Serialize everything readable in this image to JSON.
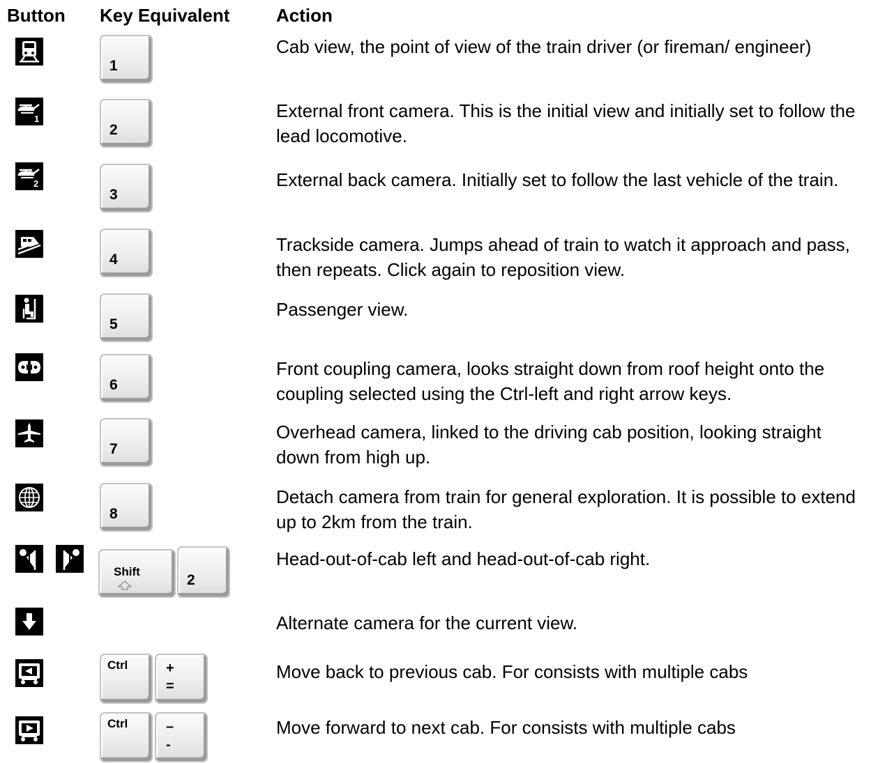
{
  "headers": {
    "button": "Button",
    "key": "Key Equivalent",
    "action": "Action"
  },
  "rows": [
    {
      "icon": "cab-view-icon",
      "key": "1",
      "action": "Cab view, the point of view of the train driver (or fireman/ engineer)"
    },
    {
      "icon": "external-front-camera-icon",
      "key": "2",
      "action": "External front camera. This is the initial view and initially set to follow the lead locomotive."
    },
    {
      "icon": "external-back-camera-icon",
      "key": "3",
      "action": "External back camera. Initially set to follow the last vehicle of the train."
    },
    {
      "icon": "trackside-camera-icon",
      "key": "4",
      "action": "Trackside camera. Jumps ahead of train to watch it approach and pass, then repeats. Click again to reposition view."
    },
    {
      "icon": "passenger-view-icon",
      "key": "5",
      "action": "Passenger view."
    },
    {
      "icon": "front-coupling-camera-icon",
      "key": "6",
      "action": "Front coupling camera, looks straight down from roof height onto the coupling selected using the Ctrl-left and right arrow keys."
    },
    {
      "icon": "overhead-camera-icon",
      "key": "7",
      "action": "Overhead camera, linked to the driving cab position, looking straight down from high up."
    },
    {
      "icon": "free-camera-globe-icon",
      "key": "8",
      "action": "Detach camera from train for general exploration. It is possible to extend up to 2km from the train."
    },
    {
      "icon": "head-out-left-icon",
      "icon2": "head-out-right-icon",
      "modifier": "Shift",
      "key": "2",
      "action": "Head-out-of-cab left and head-out-of-cab right."
    },
    {
      "icon": "alternate-camera-icon",
      "key": "",
      "action": "Alternate camera for the current view."
    },
    {
      "icon": "previous-cab-icon",
      "modifier": "Ctrl",
      "key_top": "+",
      "key_bottom": "=",
      "action": "Move back to previous cab. For consists with multiple cabs"
    },
    {
      "icon": "next-cab-icon",
      "modifier": "Ctrl",
      "key_top": "–",
      "key_bottom": "-",
      "action": "Move forward to next cab. For consists with multiple cabs"
    }
  ]
}
